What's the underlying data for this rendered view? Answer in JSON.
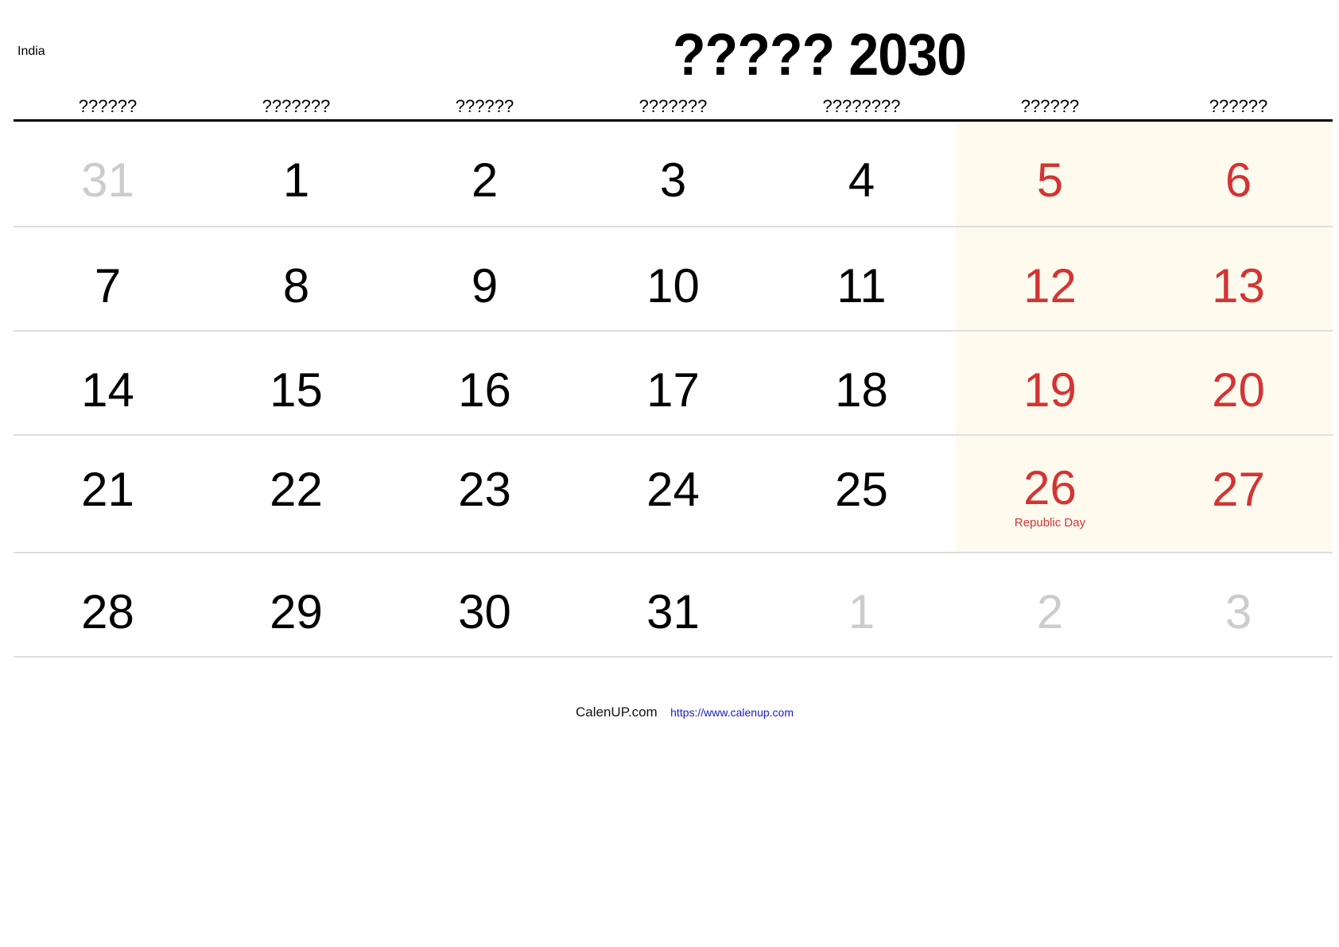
{
  "header": {
    "country": "India",
    "title": "????? 2030"
  },
  "weekdays": [
    "??????",
    "???????",
    "??????",
    "???????",
    "????????",
    "??????",
    "??????"
  ],
  "colors": {
    "weekend_background": "#fefaee",
    "weekend_text": "#d33434",
    "other_month_text": "#cccccc",
    "link": "#1a1acc"
  },
  "weeks": [
    {
      "days": [
        {
          "num": "31",
          "other": true,
          "weekend": false
        },
        {
          "num": "1",
          "other": false,
          "weekend": false
        },
        {
          "num": "2",
          "other": false,
          "weekend": false
        },
        {
          "num": "3",
          "other": false,
          "weekend": false
        },
        {
          "num": "4",
          "other": false,
          "weekend": false
        },
        {
          "num": "5",
          "other": false,
          "weekend": true
        },
        {
          "num": "6",
          "other": false,
          "weekend": true
        }
      ]
    },
    {
      "days": [
        {
          "num": "7",
          "other": false,
          "weekend": false
        },
        {
          "num": "8",
          "other": false,
          "weekend": false
        },
        {
          "num": "9",
          "other": false,
          "weekend": false
        },
        {
          "num": "10",
          "other": false,
          "weekend": false
        },
        {
          "num": "11",
          "other": false,
          "weekend": false
        },
        {
          "num": "12",
          "other": false,
          "weekend": true
        },
        {
          "num": "13",
          "other": false,
          "weekend": true
        }
      ]
    },
    {
      "days": [
        {
          "num": "14",
          "other": false,
          "weekend": false
        },
        {
          "num": "15",
          "other": false,
          "weekend": false
        },
        {
          "num": "16",
          "other": false,
          "weekend": false
        },
        {
          "num": "17",
          "other": false,
          "weekend": false
        },
        {
          "num": "18",
          "other": false,
          "weekend": false
        },
        {
          "num": "19",
          "other": false,
          "weekend": true
        },
        {
          "num": "20",
          "other": false,
          "weekend": true
        }
      ]
    },
    {
      "days": [
        {
          "num": "21",
          "other": false,
          "weekend": false
        },
        {
          "num": "22",
          "other": false,
          "weekend": false
        },
        {
          "num": "23",
          "other": false,
          "weekend": false
        },
        {
          "num": "24",
          "other": false,
          "weekend": false
        },
        {
          "num": "25",
          "other": false,
          "weekend": false
        },
        {
          "num": "26",
          "other": false,
          "weekend": true,
          "holiday": "Republic Day"
        },
        {
          "num": "27",
          "other": false,
          "weekend": true
        }
      ]
    },
    {
      "days": [
        {
          "num": "28",
          "other": false,
          "weekend": false
        },
        {
          "num": "29",
          "other": false,
          "weekend": false
        },
        {
          "num": "30",
          "other": false,
          "weekend": false
        },
        {
          "num": "31",
          "other": false,
          "weekend": false
        },
        {
          "num": "1",
          "other": true,
          "weekend": false
        },
        {
          "num": "2",
          "other": true,
          "weekend": false
        },
        {
          "num": "3",
          "other": true,
          "weekend": false
        }
      ]
    }
  ],
  "footer": {
    "brand": "CalenUP.com",
    "link": "https://www.calenup.com"
  }
}
